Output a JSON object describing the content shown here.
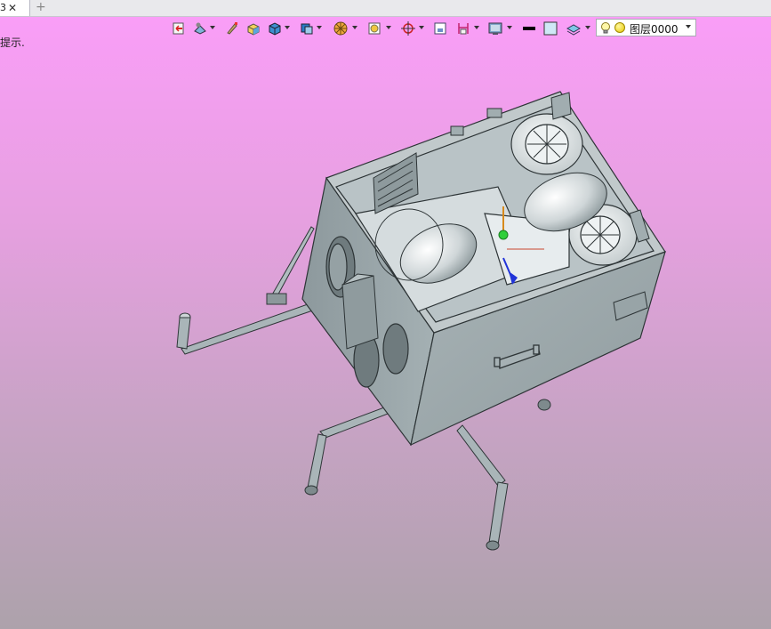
{
  "tabs": [
    {
      "label": "3",
      "close_glyph": "✕"
    }
  ],
  "tab_add_glyph": "+",
  "hint_text": "提示.",
  "toolbar": {
    "items": [
      {
        "name": "exit-sketch-icon"
      },
      {
        "name": "view-orient-icon",
        "dropdown": true
      },
      {
        "name": "brush-icon"
      },
      {
        "name": "box-shaded-icon"
      },
      {
        "name": "cube-icon",
        "dropdown": true
      },
      {
        "name": "display-style-icon",
        "dropdown": true
      },
      {
        "name": "section-icon",
        "dropdown": true
      },
      {
        "name": "frame-icon",
        "dropdown": true
      },
      {
        "name": "snap-icon",
        "dropdown": true
      },
      {
        "name": "box-select-icon"
      },
      {
        "name": "dimension-icon",
        "dropdown": true
      },
      {
        "name": "background-icon",
        "dropdown": true
      },
      {
        "name": "line-color-icon"
      },
      {
        "name": "fill-color-icon"
      },
      {
        "name": "layer-manager-icon",
        "dropdown": true
      }
    ],
    "layer_label": "图层0000"
  },
  "colors": {
    "model_gray": "#9aa6aa",
    "model_dark": "#2d3436",
    "bg_top": "#fb9ef9",
    "bg_bottom": "#ada2ab"
  },
  "viewport": {
    "model_name": "mechanical-assembly"
  }
}
